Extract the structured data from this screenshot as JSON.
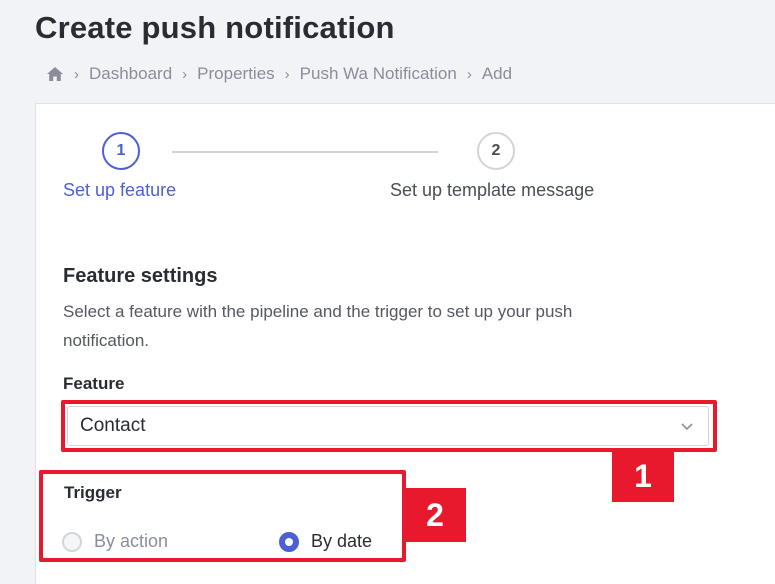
{
  "page_title": "Create push notification",
  "breadcrumb": {
    "home_icon": "home-icon",
    "items": [
      "Dashboard",
      "Properties",
      "Push Wa Notification",
      "Add"
    ]
  },
  "stepper": {
    "steps": [
      {
        "number": "1",
        "label": "Set up feature",
        "state": "active"
      },
      {
        "number": "2",
        "label": "Set up template message",
        "state": "inactive"
      }
    ]
  },
  "feature_settings": {
    "title": "Feature settings",
    "description": "Select a feature with the pipeline and the trigger to set up your push notification."
  },
  "feature": {
    "label": "Feature",
    "selected": "Contact"
  },
  "trigger": {
    "label": "Trigger",
    "options": [
      {
        "label": "By action",
        "selected": false,
        "disabled": true
      },
      {
        "label": "By date",
        "selected": true,
        "disabled": false
      }
    ]
  },
  "annotations": [
    "1",
    "2"
  ],
  "colors": {
    "accent": "#4c5fd5",
    "annotation_red": "#e8192c",
    "background": "#f2f3f7"
  }
}
